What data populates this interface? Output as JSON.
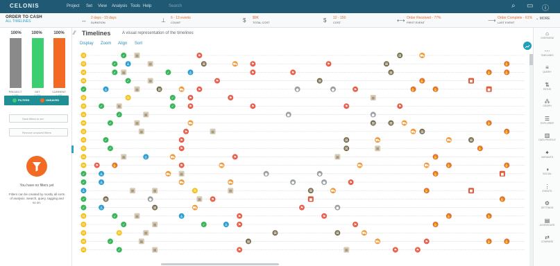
{
  "menubar": {
    "logo": "CELONIS",
    "items": [
      "Project",
      "Set",
      "View",
      "Analysis",
      "Tools",
      "Help"
    ],
    "search_placeholder": "Search"
  },
  "kpis": {
    "section_title": "ORDER TO CASH",
    "section_sub": "ALL TIMELINES",
    "items": [
      {
        "icon": "duration-icon",
        "glyph": "↔",
        "value": "2 days - 15 days",
        "label": "DURATION"
      },
      {
        "icon": "count-icon",
        "glyph": "⊥",
        "value": "6 - 13 events",
        "label": "COUNT"
      },
      {
        "icon": "dollar-icon",
        "glyph": "$",
        "value": "$0K",
        "label": "TOTAL COST"
      },
      {
        "icon": "dollar-icon",
        "glyph": "$",
        "value": "12 - 150",
        "label": "COST"
      },
      {
        "icon": "first-event-icon",
        "glyph": "⟷",
        "value": "Order Received - 77%",
        "label": "FIRST EVENT"
      },
      {
        "icon": "last-event-icon",
        "glyph": "⟶",
        "value": "Order Complete - 61%",
        "label": "LAST EVENT"
      }
    ],
    "more_label": "MORE"
  },
  "leftpanel": {
    "bars": [
      {
        "pct": "100%",
        "label": "PROJECT",
        "count": "1,151",
        "color": "#8a8a8a",
        "fill": 1.0
      },
      {
        "pct": "100%",
        "label": "SET",
        "count": "1,151",
        "color": "#3ccf6f",
        "fill": 1.0
      },
      {
        "pct": "100%",
        "label": "CURRENT",
        "count": "1,151",
        "color": "#f26a24",
        "fill": 1.0
      }
    ],
    "filters_label": "FILTERS",
    "unsaved_label": "UNSAVED",
    "save_button": "Save filters to set",
    "remove_button": "Remove unsaved filters",
    "empty_title": "You have no filters yet",
    "empty_desc": "Filters can be created by mostly all sorts of analysis. Search, query, tagging and so on."
  },
  "main": {
    "title": "Timelines",
    "subtitle": "A visual representation of the timelines",
    "tools": [
      "Display",
      "Zoom",
      "Align",
      "Sort"
    ]
  },
  "rightrail": [
    {
      "icon": "home-icon",
      "glyph": "⌂",
      "label": "OVERVIEW"
    },
    {
      "icon": "timelines-icon",
      "glyph": "⋯",
      "label": "TIMELINES"
    },
    {
      "icon": "query-icon",
      "glyph": "≡",
      "label": "QUERY"
    },
    {
      "icon": "path-icon",
      "glyph": "⇅",
      "label": "PATHS"
    },
    {
      "icon": "graph-icon",
      "glyph": "⁂",
      "label": "GRAPH"
    },
    {
      "icon": "explorer-icon",
      "glyph": "☰",
      "label": "EXPLORER"
    },
    {
      "icon": "chart-icon",
      "glyph": "▥",
      "label": "DATA PROFILE"
    },
    {
      "icon": "variants-icon",
      "glyph": "✦",
      "label": "VARIANTS"
    },
    {
      "icon": "contrast-icon",
      "glyph": "◑",
      "label": "SOCIAL"
    },
    {
      "icon": "list-icon",
      "glyph": "⋮",
      "label": "EVENTS"
    },
    {
      "icon": "gear-icon",
      "glyph": "⚙",
      "label": "SETTINGS"
    },
    {
      "icon": "aggregate-icon",
      "glyph": "▤",
      "label": "AGGREGATE"
    },
    {
      "icon": "compare-icon",
      "glyph": "⇄",
      "label": "COMPARE"
    }
  ],
  "event_types": {
    "received": {
      "color": "#f2c21b",
      "glyph": "✉"
    },
    "checked": {
      "color": "#3bb55b",
      "glyph": "✓"
    },
    "person": {
      "color": "#2f9fd1",
      "glyph": "♙"
    },
    "box": {
      "color": "#d6cbb7",
      "glyph": "■"
    },
    "factory": {
      "color": "#7a7050",
      "glyph": "⊠"
    },
    "truck": {
      "color": "#f09a3a",
      "glyph": "⛟"
    },
    "invoice": {
      "color": "#e8604c",
      "glyph": "⚑"
    },
    "pay": {
      "color": "#e0703a",
      "glyph": "✋"
    },
    "gray": {
      "color": "#9aa0a3",
      "glyph": "●"
    },
    "redbox": {
      "color": "#e05a3c",
      "glyph": "■"
    }
  },
  "timelines": [
    [
      [
        "received",
        0.01
      ],
      [
        "checked",
        0.1
      ],
      [
        "box",
        0.13
      ],
      [
        "invoice",
        0.27
      ],
      [
        "factory",
        0.72
      ],
      [
        "truck",
        0.77
      ]
    ],
    [
      [
        "received",
        0.01
      ],
      [
        "checked",
        0.08
      ],
      [
        "person",
        0.11
      ],
      [
        "box",
        0.16
      ],
      [
        "factory",
        0.28
      ],
      [
        "truck",
        0.35
      ],
      [
        "invoice",
        0.39
      ],
      [
        "invoice",
        0.56
      ],
      [
        "factory",
        0.69
      ],
      [
        "pay",
        0.96
      ]
    ],
    [
      [
        "received",
        0.01
      ],
      [
        "checked",
        0.08
      ],
      [
        "box",
        0.1
      ],
      [
        "checked",
        0.2
      ],
      [
        "person",
        0.25
      ],
      [
        "invoice",
        0.39
      ],
      [
        "invoice",
        0.48
      ],
      [
        "factory",
        0.7
      ],
      [
        "pay",
        0.92
      ],
      [
        "pay",
        0.96
      ]
    ],
    [
      [
        "received",
        0.01
      ],
      [
        "checked",
        0.11
      ],
      [
        "box",
        0.16
      ],
      [
        "invoice",
        0.31
      ],
      [
        "factory",
        0.54
      ],
      [
        "pay",
        0.77
      ],
      [
        "redbox",
        0.88
      ]
    ],
    [
      [
        "checked",
        0.01
      ],
      [
        "person",
        0.06
      ],
      [
        "box",
        0.13
      ],
      [
        "factory",
        0.18
      ],
      [
        "truck",
        0.23
      ],
      [
        "invoice",
        0.27
      ],
      [
        "gray",
        0.49
      ],
      [
        "gray",
        0.57
      ],
      [
        "invoice",
        0.62
      ],
      [
        "pay",
        0.75
      ],
      [
        "pay",
        0.8
      ],
      [
        "redbox",
        0.92
      ]
    ],
    [
      [
        "received",
        0.01
      ],
      [
        "received",
        0.11
      ],
      [
        "checked",
        0.21
      ],
      [
        "invoice",
        0.25
      ],
      [
        "invoice",
        0.34
      ],
      [
        "box",
        0.66
      ]
    ],
    [
      [
        "received",
        0.01
      ],
      [
        "checked",
        0.05
      ],
      [
        "box",
        0.09
      ],
      [
        "checked",
        0.21
      ],
      [
        "invoice",
        0.25
      ],
      [
        "invoice",
        0.39
      ],
      [
        "invoice",
        0.6
      ],
      [
        "invoice",
        0.72
      ]
    ],
    [
      [
        "received",
        0.01
      ],
      [
        "checked",
        0.09
      ],
      [
        "box",
        0.15
      ],
      [
        "gray",
        0.47
      ],
      [
        "gray",
        0.66
      ]
    ],
    [
      [
        "received",
        0.01
      ],
      [
        "checked",
        0.07
      ],
      [
        "box",
        0.13
      ],
      [
        "truck",
        0.25
      ],
      [
        "factory",
        0.66
      ],
      [
        "factory",
        0.7
      ],
      [
        "truck",
        0.73
      ],
      [
        "pay",
        0.92
      ]
    ],
    [
      [
        "received",
        0.01
      ],
      [
        "box",
        0.14
      ],
      [
        "invoice",
        0.24
      ],
      [
        "box",
        0.3
      ],
      [
        "truck",
        0.75
      ],
      [
        "factory",
        0.77
      ],
      [
        "pay",
        0.96
      ]
    ],
    [
      [
        "received",
        0.01
      ],
      [
        "checked",
        0.06
      ],
      [
        "invoice",
        0.23
      ],
      [
        "factory",
        0.6
      ],
      [
        "truck",
        0.67
      ],
      [
        "truck",
        0.83
      ],
      [
        "factory",
        0.88
      ]
    ],
    [
      [
        "received",
        0.01
      ],
      [
        "checked",
        0.07
      ],
      [
        "invoice",
        0.23
      ],
      [
        "factory",
        0.6
      ],
      [
        "box",
        0.67
      ],
      [
        "pay",
        0.9
      ]
    ],
    [
      [
        "received",
        0.01
      ],
      [
        "box",
        0.1
      ],
      [
        "person",
        0.15
      ],
      [
        "truck",
        0.21
      ],
      [
        "invoice",
        0.35
      ],
      [
        "box",
        0.58
      ],
      [
        "pay",
        0.8
      ]
    ],
    [
      [
        "received",
        0.01
      ],
      [
        "invoice",
        0.04
      ],
      [
        "pay",
        0.08
      ],
      [
        "invoice",
        0.23
      ],
      [
        "truck",
        0.32
      ],
      [
        "truck",
        0.63
      ],
      [
        "truck",
        0.78
      ],
      [
        "pay",
        0.83
      ],
      [
        "pay",
        0.96
      ]
    ],
    [
      [
        "checked",
        0.01
      ],
      [
        "person",
        0.05
      ],
      [
        "truck",
        0.2
      ],
      [
        "box",
        0.23
      ],
      [
        "gray",
        0.42
      ],
      [
        "gray",
        0.54
      ],
      [
        "pay",
        0.8
      ],
      [
        "redbox",
        0.95
      ]
    ],
    [
      [
        "checked",
        0.01
      ],
      [
        "person",
        0.05
      ],
      [
        "truck",
        0.23
      ],
      [
        "truck",
        0.34
      ],
      [
        "gray",
        0.48
      ],
      [
        "gray",
        0.55
      ],
      [
        "invoice",
        0.61
      ]
    ],
    [
      [
        "person",
        0.01
      ],
      [
        "box",
        0.12
      ],
      [
        "box",
        0.17
      ],
      [
        "received",
        0.26
      ],
      [
        "box",
        0.34
      ],
      [
        "factory",
        0.52
      ],
      [
        "truck",
        0.57
      ],
      [
        "pay",
        0.78
      ],
      [
        "redbox",
        0.88
      ]
    ],
    [
      [
        "checked",
        0.01
      ],
      [
        "factory",
        0.06
      ],
      [
        "gray",
        0.16
      ],
      [
        "box",
        0.27
      ],
      [
        "invoice",
        0.3
      ],
      [
        "redbox",
        0.52
      ],
      [
        "pay",
        0.95
      ]
    ],
    [
      [
        "checked",
        0.01
      ],
      [
        "person",
        0.05
      ],
      [
        "factory",
        0.17
      ],
      [
        "truck",
        0.26
      ],
      [
        "invoice",
        0.5
      ],
      [
        "gray",
        0.58
      ]
    ],
    [
      [
        "received",
        0.01
      ],
      [
        "checked",
        0.08
      ],
      [
        "box",
        0.13
      ],
      [
        "person",
        0.23
      ],
      [
        "invoice",
        0.36
      ],
      [
        "invoice",
        0.55
      ],
      [
        "pay",
        0.83
      ],
      [
        "pay",
        0.92
      ]
    ],
    [
      [
        "received",
        0.01
      ],
      [
        "checked",
        0.1
      ],
      [
        "box",
        0.17
      ],
      [
        "checked",
        0.28
      ],
      [
        "person",
        0.33
      ],
      [
        "invoice",
        0.36
      ],
      [
        "invoice",
        0.62
      ],
      [
        "pay",
        0.8
      ]
    ],
    [
      [
        "received",
        0.01
      ],
      [
        "received",
        0.09
      ],
      [
        "box",
        0.15
      ],
      [
        "factory",
        0.44
      ],
      [
        "factory",
        0.58
      ],
      [
        "truck",
        0.64
      ]
    ],
    [
      [
        "received",
        0.01
      ],
      [
        "checked",
        0.07
      ],
      [
        "box",
        0.14
      ],
      [
        "factory",
        0.38
      ],
      [
        "truck",
        0.67
      ],
      [
        "invoice",
        0.78
      ],
      [
        "pay",
        0.92
      ],
      [
        "pay",
        0.96
      ]
    ],
    [
      [
        "received",
        0.01
      ],
      [
        "checked",
        0.09
      ],
      [
        "box",
        0.17
      ],
      [
        "invoice",
        0.36
      ],
      [
        "box",
        0.6
      ],
      [
        "invoice",
        0.71
      ],
      [
        "invoice",
        0.76
      ]
    ]
  ]
}
